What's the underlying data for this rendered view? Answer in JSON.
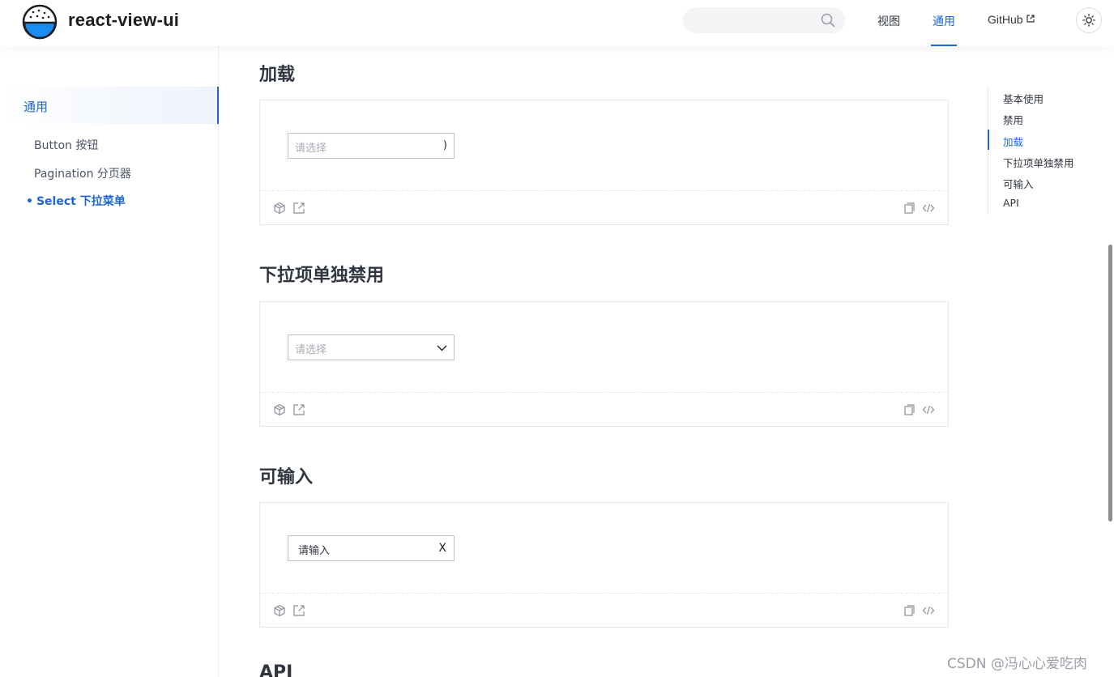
{
  "header": {
    "brand": "react-view-ui",
    "search_placeholder": "",
    "nav": [
      {
        "label": "视图"
      },
      {
        "label": "通用"
      },
      {
        "label": "GitHub"
      }
    ]
  },
  "sidebar": {
    "group": "通用",
    "items": [
      {
        "label": "Button 按钮"
      },
      {
        "label": "Pagination 分页器"
      },
      {
        "label": "Select 下拉菜单"
      }
    ]
  },
  "sections": [
    {
      "title": "加载",
      "select": {
        "placeholder": "请选择",
        "suffix": ")"
      }
    },
    {
      "title": "下拉项单独禁用",
      "select": {
        "placeholder": "请选择"
      }
    },
    {
      "title": "可输入",
      "select": {
        "value": "请输入",
        "suffix": "X"
      }
    },
    {
      "title": "API"
    }
  ],
  "toc": [
    "基本使用",
    "禁用",
    "加载",
    "下拉项单独禁用",
    "可输入",
    "API"
  ],
  "watermark": "CSDN @冯心心爱吃肉",
  "colors": {
    "accent": "#1e66d0",
    "text": "#30363f",
    "border": "#e6e8eb"
  },
  "icons": [
    "search-icon",
    "external-link-icon",
    "sun-icon",
    "codesandbox-icon",
    "open-new-window-icon",
    "copy-icon",
    "code-icon",
    "chevron-down-icon"
  ]
}
